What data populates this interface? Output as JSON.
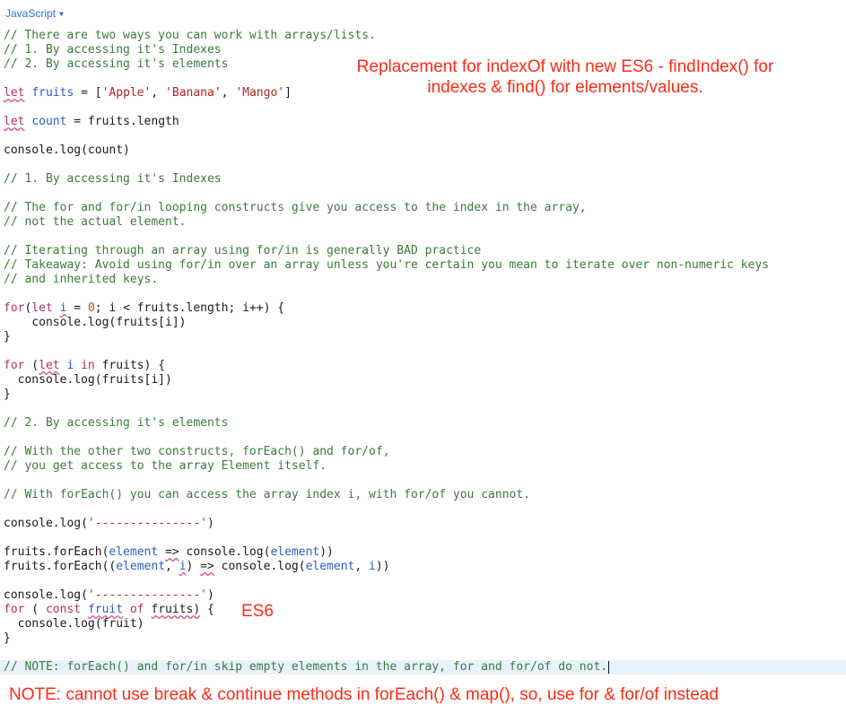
{
  "editor": {
    "language": "JavaScript",
    "lines": [
      [
        {
          "t": "// There are two ways you can work with arrays/lists.",
          "c": "c"
        }
      ],
      [
        {
          "t": "// 1. By accessing it's Indexes",
          "c": "c"
        }
      ],
      [
        {
          "t": "// 2. By accessing it's elements",
          "c": "c"
        }
      ],
      [],
      [
        {
          "t": "let",
          "c": "k sq"
        },
        {
          "t": " "
        },
        {
          "t": "fruits",
          "c": "v"
        },
        {
          "t": " = ["
        },
        {
          "t": "'Apple'",
          "c": "s"
        },
        {
          "t": ", "
        },
        {
          "t": "'Banana'",
          "c": "s"
        },
        {
          "t": ", "
        },
        {
          "t": "'Mango'",
          "c": "s"
        },
        {
          "t": "]"
        }
      ],
      [],
      [
        {
          "t": "let",
          "c": "k sq"
        },
        {
          "t": " "
        },
        {
          "t": "count",
          "c": "v"
        },
        {
          "t": " = fruits.length"
        }
      ],
      [],
      [
        {
          "t": "console.log(count)"
        }
      ],
      [],
      [
        {
          "t": "// 1. By accessing it's Indexes",
          "c": "c"
        }
      ],
      [],
      [
        {
          "t": "// The for and for/in looping constructs give you access to the index in the array,",
          "c": "c"
        }
      ],
      [
        {
          "t": "// not the actual element.",
          "c": "c"
        }
      ],
      [],
      [
        {
          "t": "// Iterating through an array using for/in is generally BAD practice",
          "c": "c"
        }
      ],
      [
        {
          "t": "// Takeaway: Avoid using for/in over an array unless you're certain you mean to iterate over non-numeric keys",
          "c": "c"
        }
      ],
      [
        {
          "t": "// and inherited keys.",
          "c": "c"
        }
      ],
      [],
      [
        {
          "t": "for",
          "c": "k"
        },
        {
          "t": "("
        },
        {
          "t": "let",
          "c": "k"
        },
        {
          "t": " "
        },
        {
          "t": "i",
          "c": "v sq"
        },
        {
          "t": " = "
        },
        {
          "t": "0",
          "c": "n"
        },
        {
          "t": "; i < fruits.length; i++) {"
        }
      ],
      [
        {
          "t": "    console.log(fruits[i])"
        }
      ],
      [
        {
          "t": "}"
        }
      ],
      [],
      [
        {
          "t": "for",
          "c": "k"
        },
        {
          "t": " ("
        },
        {
          "t": "let",
          "c": "k sq"
        },
        {
          "t": " "
        },
        {
          "t": "i",
          "c": "v"
        },
        {
          "t": " "
        },
        {
          "t": "in",
          "c": "k"
        },
        {
          "t": " fruits) {"
        }
      ],
      [
        {
          "t": "  console.log(fruits[i])"
        }
      ],
      [
        {
          "t": "}"
        }
      ],
      [],
      [
        {
          "t": "// 2. By accessing it's elements",
          "c": "c"
        }
      ],
      [],
      [
        {
          "t": "// With the other two constructs, forEach() and for/of,",
          "c": "c"
        }
      ],
      [
        {
          "t": "// you get access to the array Element itself.",
          "c": "c"
        }
      ],
      [],
      [
        {
          "t": "// With forEach() you can access the array index i, with for/of you cannot.",
          "c": "c"
        }
      ],
      [],
      [
        {
          "t": "console.log("
        },
        {
          "t": "'---------------'",
          "c": "s"
        },
        {
          "t": ")"
        }
      ],
      [],
      [
        {
          "t": "fruits.forEach("
        },
        {
          "t": "element",
          "c": "v"
        },
        {
          "t": " "
        },
        {
          "t": "=>",
          "c": "sq"
        },
        {
          "t": " console.log("
        },
        {
          "t": "element",
          "c": "v"
        },
        {
          "t": "))"
        }
      ],
      [
        {
          "t": "fruits.forEach(("
        },
        {
          "t": "element",
          "c": "v"
        },
        {
          "t": ", "
        },
        {
          "t": "i",
          "c": "v sq"
        },
        {
          "t": ") "
        },
        {
          "t": "=>",
          "c": "sq"
        },
        {
          "t": " console.log("
        },
        {
          "t": "element",
          "c": "v"
        },
        {
          "t": ", "
        },
        {
          "t": "i",
          "c": "v"
        },
        {
          "t": "))"
        }
      ],
      [],
      [
        {
          "t": "console.log("
        },
        {
          "t": "'---------------'",
          "c": "s"
        },
        {
          "t": ")"
        }
      ],
      [
        {
          "t": "for",
          "c": "k"
        },
        {
          "t": " ( "
        },
        {
          "t": "const",
          "c": "k"
        },
        {
          "t": " "
        },
        {
          "t": "fruit",
          "c": "v sq"
        },
        {
          "t": " "
        },
        {
          "t": "of",
          "c": "k"
        },
        {
          "t": " "
        },
        {
          "t": "fruits)",
          "c": "sq"
        },
        {
          "t": " {"
        }
      ],
      [
        {
          "t": "  console.log(fruit)"
        }
      ],
      [
        {
          "t": "}"
        }
      ],
      [],
      [
        {
          "t": "// NOTE: forEach() and for/in skip empty elements in the array, for and for/of do not.",
          "c": "c"
        }
      ]
    ],
    "active_line": 44
  },
  "annotations": {
    "top": "Replacement for indexOf with new ES6 - findIndex() for indexes & find() for elements/values.",
    "top_line1": "Replacement for indexOf with new ES6 - findIndex() for",
    "top_line2": "indexes & find() for elements/values.",
    "es6": "ES6",
    "note": "NOTE: cannot use break & continue methods in forEach() & map(), so, use for & for/of instead",
    "color": "#ff2a14"
  },
  "colors": {
    "comment": "#3c7a3c",
    "keyword": "#b0306a",
    "variable": "#2e5cc0",
    "string": "#b22222",
    "number": "#a0522d",
    "language_link": "#2a6fd6",
    "active_line_bg": "#e8f2fd"
  },
  "icons": {
    "language_dropdown": "caret-down-icon"
  }
}
